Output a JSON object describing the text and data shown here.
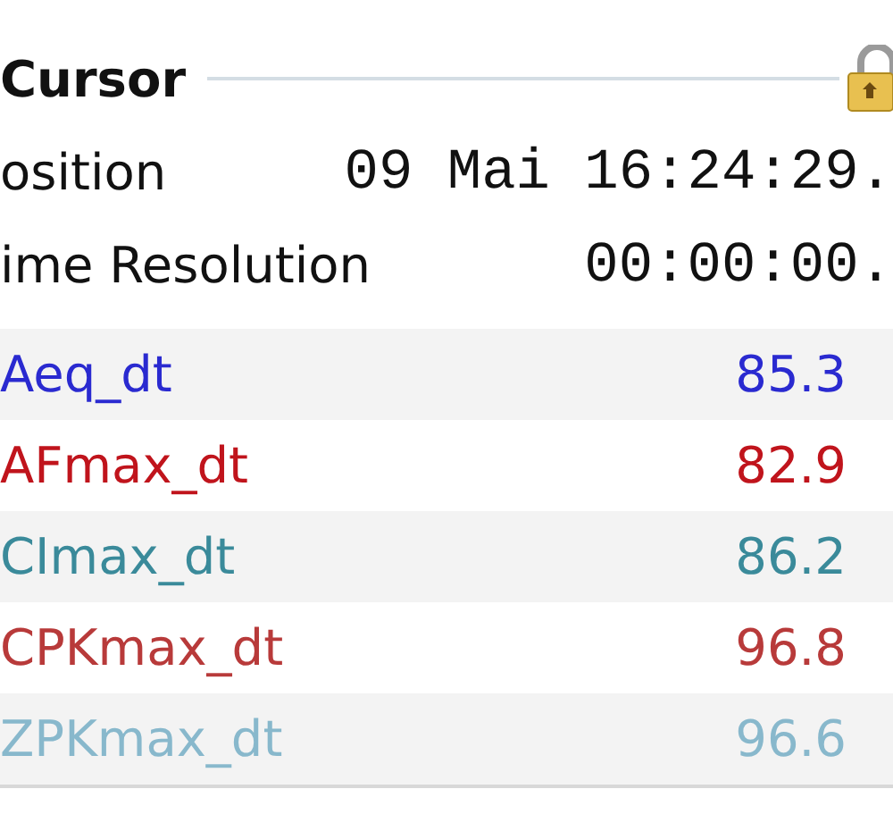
{
  "section": {
    "title": "Cursor"
  },
  "fields": [
    {
      "label": "osition",
      "value": "09 Mai 16:24:29."
    },
    {
      "label": "ime Resolution",
      "value": "00:00:00."
    }
  ],
  "channels": [
    {
      "name": "Aeq_dt",
      "value": "85.3",
      "color": "#2a2ad0"
    },
    {
      "name": "AFmax_dt",
      "value": "82.9",
      "color": "#c0141c"
    },
    {
      "name": "CImax_dt",
      "value": "86.2",
      "color": "#3a8a9a"
    },
    {
      "name": "CPKmax_dt",
      "value": "96.8",
      "color": "#b83a3a"
    },
    {
      "name": "ZPKmax_dt",
      "value": "96.6",
      "color": "#88b8cc"
    }
  ]
}
